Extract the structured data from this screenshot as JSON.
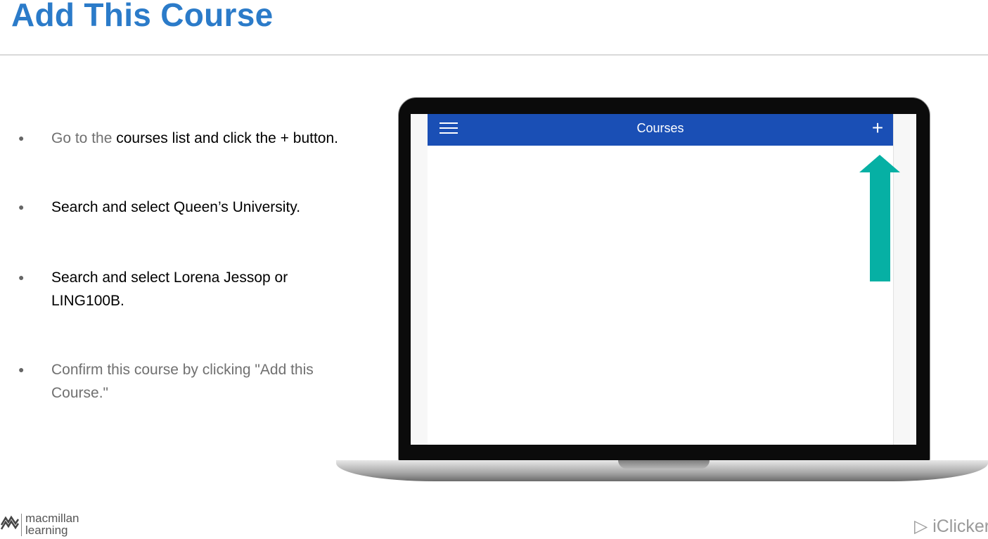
{
  "slide": {
    "title": "Add This Course"
  },
  "bullets": [
    {
      "prefix": "Go to the ",
      "text": "courses list and click the + button."
    },
    {
      "text": "Search and select Queen’s University."
    },
    {
      "line1": "Search and select Lorena Jessop or",
      "line2": "LING100B."
    },
    {
      "line1": "Confirm this course by clicking \"Add this",
      "line2": "Course.\""
    }
  ],
  "bullet_glyph": "●",
  "app": {
    "title": "Courses",
    "plus_symbol": "+",
    "bar_color": "#1a4fb5"
  },
  "arrow_color": "#06b0a4",
  "footer": {
    "brand_line1": "macmillan",
    "brand_line2": "learning",
    "right_brand": "iClicker"
  }
}
